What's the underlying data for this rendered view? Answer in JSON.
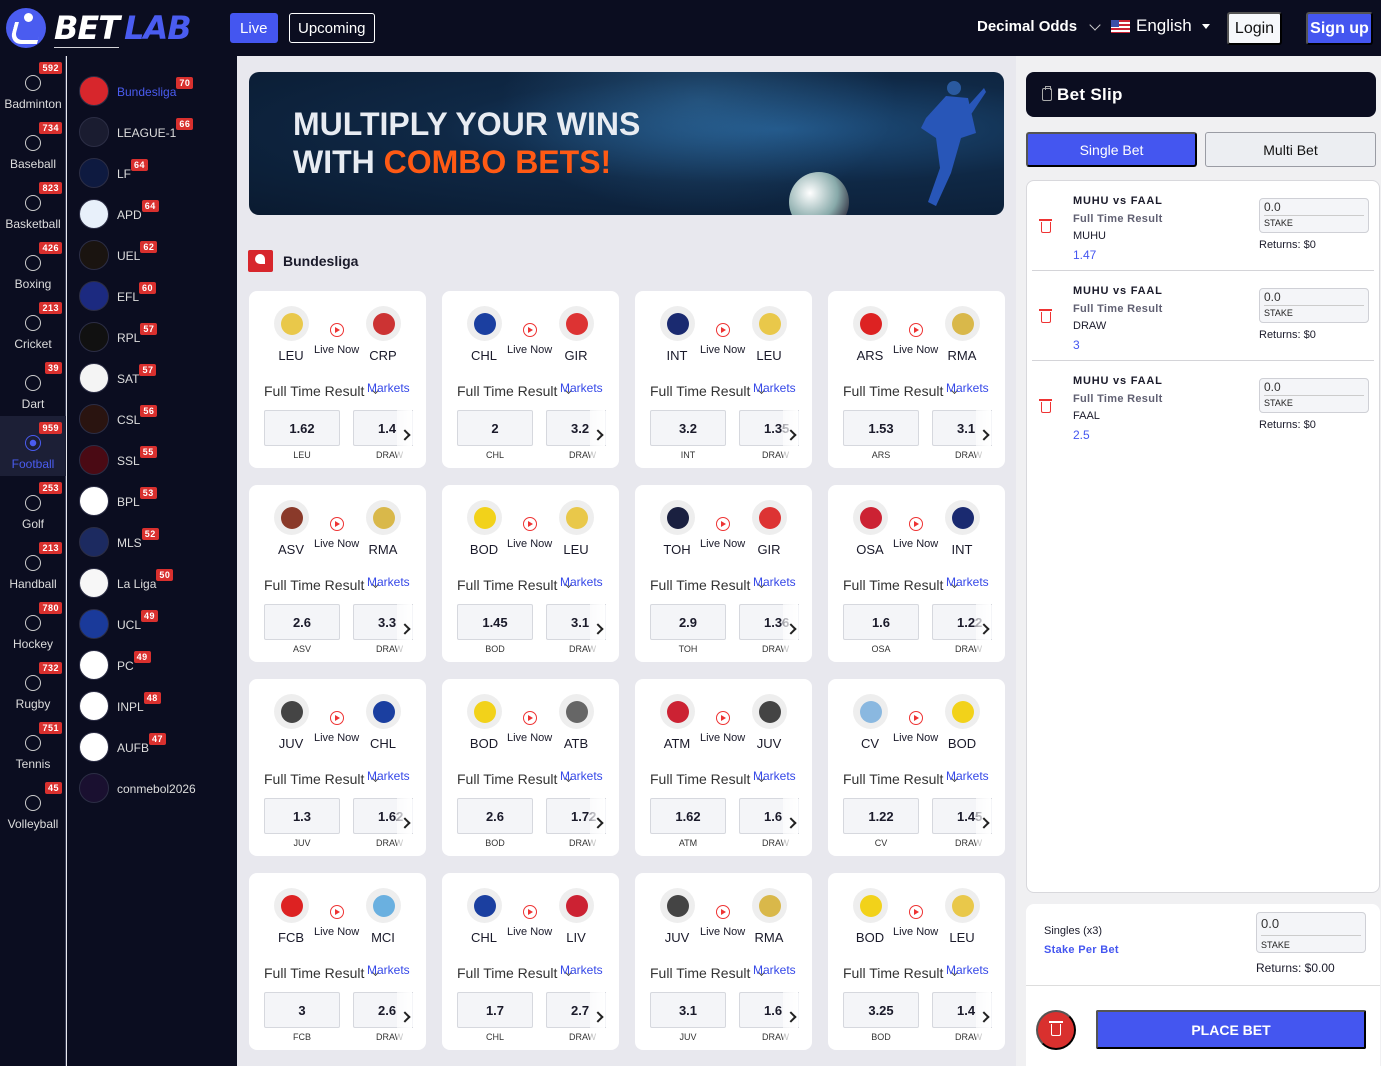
{
  "brand": {
    "bet": "BET",
    "lab": "LAB",
    "accent": "#4456f0"
  },
  "nav": {
    "live": "Live",
    "upcoming": "Upcoming"
  },
  "header": {
    "odds_format": "Decimal Odds",
    "language": "English",
    "login": "Login",
    "signup": "Sign up"
  },
  "sports": [
    {
      "label": "Badminton",
      "count": "592",
      "icon": "badminton-icon"
    },
    {
      "label": "Baseball",
      "count": "734",
      "icon": "baseball-icon"
    },
    {
      "label": "Basketball",
      "count": "823",
      "icon": "basketball-icon"
    },
    {
      "label": "Boxing",
      "count": "426",
      "icon": "boxing-glove-icon"
    },
    {
      "label": "Cricket",
      "count": "213",
      "icon": "cricket-icon"
    },
    {
      "label": "Dart",
      "count": "39",
      "icon": "dart-icon"
    },
    {
      "label": "Football",
      "count": "959",
      "icon": "football-icon",
      "active": true
    },
    {
      "label": "Golf",
      "count": "253",
      "icon": "golf-icon"
    },
    {
      "label": "Handball",
      "count": "213",
      "icon": "handball-icon"
    },
    {
      "label": "Hockey",
      "count": "780",
      "icon": "hockey-icon"
    },
    {
      "label": "Rugby",
      "count": "732",
      "icon": "rugby-icon"
    },
    {
      "label": "Tennis",
      "count": "751",
      "icon": "tennis-icon"
    },
    {
      "label": "Volleyball",
      "count": "45",
      "icon": "volleyball-icon"
    }
  ],
  "leagues": [
    {
      "name": "Bundesliga",
      "count": "70",
      "active": true
    },
    {
      "name": "LEAGUE-1",
      "count": "66"
    },
    {
      "name": "LF",
      "count": "64"
    },
    {
      "name": "APD",
      "count": "64"
    },
    {
      "name": "UEL",
      "count": "62"
    },
    {
      "name": "EFL",
      "count": "60"
    },
    {
      "name": "RPL",
      "count": "57"
    },
    {
      "name": "SAT",
      "count": "57"
    },
    {
      "name": "CSL",
      "count": "56"
    },
    {
      "name": "SSL",
      "count": "55"
    },
    {
      "name": "BPL",
      "count": "53"
    },
    {
      "name": "MLS",
      "count": "52"
    },
    {
      "name": "La Liga",
      "count": "50"
    },
    {
      "name": "UCL",
      "count": "49"
    },
    {
      "name": "PC",
      "count": "49"
    },
    {
      "name": "INPL",
      "count": "48"
    },
    {
      "name": "AUFB",
      "count": "47"
    },
    {
      "name": "conmebol2026",
      "count": ""
    }
  ],
  "banner": {
    "line1": "MULTIPLY YOUR WINS",
    "line2_prefix": "WITH ",
    "line2_highlight": "COMBO BETS!"
  },
  "section": {
    "title": "Bundesliga"
  },
  "match_common": {
    "live_text": "Live Now",
    "market": "Full Time Result",
    "markets_link": "Markets",
    "draw_label": "DRAW"
  },
  "matches": [
    {
      "home": "LEU",
      "away": "CRP",
      "home_odd": "1.62",
      "draw_odd": "1.4",
      "home_color": "#e9c84a",
      "away_color": "#c33"
    },
    {
      "home": "CHL",
      "away": "GIR",
      "home_odd": "2",
      "draw_odd": "3.2",
      "home_color": "#1b3fa0",
      "away_color": "#d33"
    },
    {
      "home": "INT",
      "away": "LEU",
      "home_odd": "3.2",
      "draw_odd": "1.35",
      "home_color": "#1a2a70",
      "away_color": "#e9c84a"
    },
    {
      "home": "ARS",
      "away": "RMA",
      "home_odd": "1.53",
      "draw_odd": "3.1",
      "home_color": "#d22",
      "away_color": "#d9b84a"
    },
    {
      "home": "ASV",
      "away": "RMA",
      "home_odd": "2.6",
      "draw_odd": "3.3",
      "home_color": "#8a3a2a",
      "away_color": "#d9b84a"
    },
    {
      "home": "BOD",
      "away": "LEU",
      "home_odd": "1.45",
      "draw_odd": "3.1",
      "home_color": "#f2d21a",
      "away_color": "#e9c84a"
    },
    {
      "home": "TOH",
      "away": "GIR",
      "home_odd": "2.9",
      "draw_odd": "1.36",
      "home_color": "#1a2040",
      "away_color": "#d33"
    },
    {
      "home": "OSA",
      "away": "INT",
      "home_odd": "1.6",
      "draw_odd": "1.22",
      "home_color": "#c23",
      "away_color": "#1a2a70"
    },
    {
      "home": "JUV",
      "away": "CHL",
      "home_odd": "1.3",
      "draw_odd": "1.62",
      "home_color": "#444",
      "away_color": "#1b3fa0"
    },
    {
      "home": "BOD",
      "away": "ATB",
      "home_odd": "2.6",
      "draw_odd": "1.72",
      "home_color": "#f2d21a",
      "away_color": "#666"
    },
    {
      "home": "ATM",
      "away": "JUV",
      "home_odd": "1.62",
      "draw_odd": "1.6",
      "home_color": "#c23",
      "away_color": "#444"
    },
    {
      "home": "CV",
      "away": "BOD",
      "home_odd": "1.22",
      "draw_odd": "1.45",
      "home_color": "#8ab8e0",
      "away_color": "#f2d21a"
    },
    {
      "home": "FCB",
      "away": "MCI",
      "home_odd": "3",
      "draw_odd": "2.6",
      "home_color": "#d22",
      "away_color": "#6ab0e0"
    },
    {
      "home": "CHL",
      "away": "LIV",
      "home_odd": "1.7",
      "draw_odd": "2.7",
      "home_color": "#1b3fa0",
      "away_color": "#c23"
    },
    {
      "home": "JUV",
      "away": "RMA",
      "home_odd": "3.1",
      "draw_odd": "1.6",
      "home_color": "#444",
      "away_color": "#d9b84a"
    },
    {
      "home": "BOD",
      "away": "LEU",
      "home_odd": "3.25",
      "draw_odd": "1.4",
      "home_color": "#f2d21a",
      "away_color": "#e9c84a"
    }
  ],
  "betslip": {
    "title": "Bet Slip",
    "tab_single": "Single Bet",
    "tab_multi": "Multi Bet",
    "stake_label": "STAKE",
    "bets": [
      {
        "match": "MUHU vs FAAL",
        "market": "Full Time Result",
        "pick": "MUHU",
        "price": "1.47",
        "stake": "0.0",
        "returns": "Returns: $0"
      },
      {
        "match": "MUHU vs FAAL",
        "market": "Full Time Result",
        "pick": "DRAW",
        "price": "3",
        "stake": "0.0",
        "returns": "Returns: $0"
      },
      {
        "match": "MUHU vs FAAL",
        "market": "Full Time Result",
        "pick": "FAAL",
        "price": "2.5",
        "stake": "0.0",
        "returns": "Returns: $0"
      }
    ],
    "footer": {
      "singles": "Singles (x3)",
      "stake_per_bet": "Stake Per Bet",
      "stake": "0.0",
      "returns": "Returns: $0.00",
      "place_bet": "PLACE BET"
    }
  }
}
